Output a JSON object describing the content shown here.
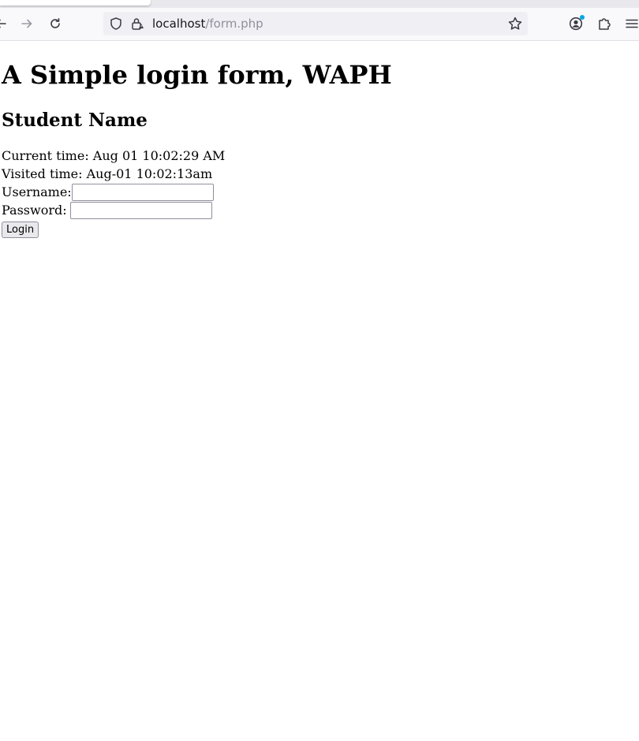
{
  "browser": {
    "url_host": "localhost",
    "url_path": "/form.php",
    "icons": {
      "back": "back-arrow-icon",
      "forward": "forward-arrow-icon",
      "reload": "reload-icon",
      "shield": "tracking-protection-shield-icon",
      "lock": "insecure-lock-icon",
      "bookmark": "bookmark-star-icon",
      "account": "account-icon",
      "extensions": "extensions-puzzle-icon",
      "menu": "hamburger-menu-icon"
    },
    "accent_color": "#00a7e3"
  },
  "page": {
    "title": "A Simple login form, WAPH",
    "student_name": "Student Name",
    "current_time": "Current time: Aug 01 10:02:29 AM",
    "visited_time": "Visited time: Aug-01 10:02:13am",
    "form": {
      "username_label": "Username:",
      "username_value": "",
      "password_label": "Password:",
      "password_value": "",
      "login_button": "Login"
    }
  }
}
